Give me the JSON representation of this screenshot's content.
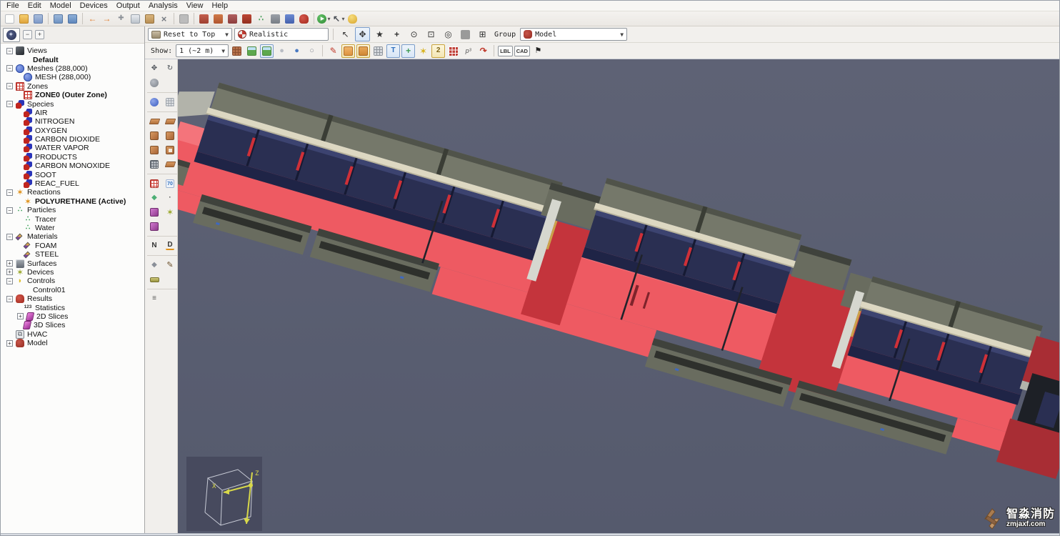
{
  "menubar": {
    "items": [
      "File",
      "Edit",
      "Model",
      "Devices",
      "Output",
      "Analysis",
      "View",
      "Help"
    ]
  },
  "main_toolbar": {
    "icons": [
      "new-file",
      "open-folder",
      "save",
      "import-model",
      "export-model",
      "undo",
      "redo",
      "attach",
      "copy",
      "paste",
      "delete",
      "selection-box",
      "new-mesh",
      "new-zone",
      "new-species",
      "new-reaction",
      "new-particle",
      "new-surface",
      "new-slice",
      "new-results",
      "run-simulation",
      "pointer-mode",
      "record-lock"
    ]
  },
  "panel_header": {
    "collapse_all": "−",
    "expand_all": "+"
  },
  "tree": {
    "items": [
      {
        "label": "Views"
      },
      {
        "label": "Default"
      },
      {
        "label": "Meshes (288,000)"
      },
      {
        "label": "MESH (288,000)"
      },
      {
        "label": "Zones"
      },
      {
        "label": "ZONE0 (Outer Zone)"
      },
      {
        "label": "Species"
      },
      {
        "label": "AIR"
      },
      {
        "label": "NITROGEN"
      },
      {
        "label": "OXYGEN"
      },
      {
        "label": "CARBON DIOXIDE"
      },
      {
        "label": "WATER VAPOR"
      },
      {
        "label": "PRODUCTS"
      },
      {
        "label": "CARBON MONOXIDE"
      },
      {
        "label": "SOOT"
      },
      {
        "label": "REAC_FUEL"
      },
      {
        "label": "Reactions"
      },
      {
        "label": "POLYURETHANE (Active)"
      },
      {
        "label": "Particles"
      },
      {
        "label": "Tracer"
      },
      {
        "label": "Water"
      },
      {
        "label": "Materials"
      },
      {
        "label": "FOAM"
      },
      {
        "label": "STEEL"
      },
      {
        "label": "Surfaces"
      },
      {
        "label": "Devices"
      },
      {
        "label": "Controls"
      },
      {
        "label": "Control01"
      },
      {
        "label": "Results"
      },
      {
        "label": "Statistics"
      },
      {
        "label": "2D Slices"
      },
      {
        "label": "3D Slices"
      },
      {
        "label": "HVAC"
      },
      {
        "label": "Model"
      }
    ]
  },
  "view_toolbar": {
    "camera": "Reset to Top",
    "render_mode": "Realistic",
    "group_label": "Group",
    "group_value": "Model",
    "nav_icons": [
      "select-tool",
      "orbit-tool",
      "roam-tool",
      "pan-tool",
      "zoom-tool",
      "zoom-box-tool",
      "zoom-fit-tool",
      "fast-render-toggle",
      "viewport-layout"
    ]
  },
  "show_toolbar": {
    "label": "Show:",
    "resolution": "1 (~2 m)",
    "lbl": "LBL",
    "cad": "CAD",
    "buttons": [
      "grid-toggle",
      "background-toggle",
      "preview-toggle",
      "wireframe-mode",
      "smooth-mode",
      "outline-mode",
      "paint-tool",
      "obstruction-paint",
      "hole-paint",
      "texture-tool",
      "text-labels-toggle",
      "crosshair-toggle",
      "devices-toggle",
      "two-d-mode",
      "slice-toggle",
      "points-toggle",
      "rotate-reset",
      "lbl-toggle",
      "cad-toggle",
      "flag-marker"
    ]
  },
  "side_toolbar": {
    "n": "N",
    "d": "D",
    "t70": "70"
  },
  "viewport": {
    "axis": {
      "x": "X",
      "z": "Z"
    },
    "watermark": {
      "name": "智淼消防",
      "site": "zmjaxf.com"
    },
    "colors": {
      "background": "#565a6d",
      "floor": "#ee5a62",
      "vestibule": "#c4343c",
      "seat": "#2a2f52",
      "rail": "#ddd8c2",
      "panel": "#6b6e62",
      "handle": "#cf3038"
    }
  }
}
